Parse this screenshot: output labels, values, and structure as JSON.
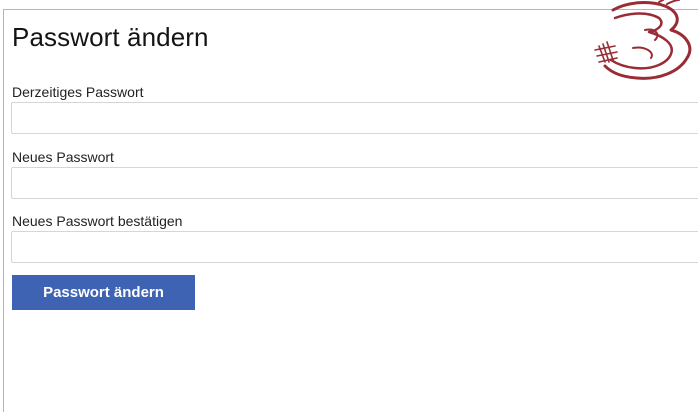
{
  "page": {
    "title": "Passwort ändern"
  },
  "form": {
    "fields": [
      {
        "label": "Derzeitiges Passwort",
        "value": "",
        "type": "password"
      },
      {
        "label": "Neues Passwort",
        "value": "",
        "type": "password"
      },
      {
        "label": "Neues Passwort bestätigen",
        "value": "",
        "type": "password"
      }
    ],
    "submit_label": "Passwort ändern"
  },
  "decoration": {
    "logo_icon": "hand-drawn-number-3-icon",
    "logo_color": "#9a2c35"
  },
  "colors": {
    "button": "#3f63b3",
    "button_text": "#ffffff",
    "input_border": "#d6d6d6"
  }
}
